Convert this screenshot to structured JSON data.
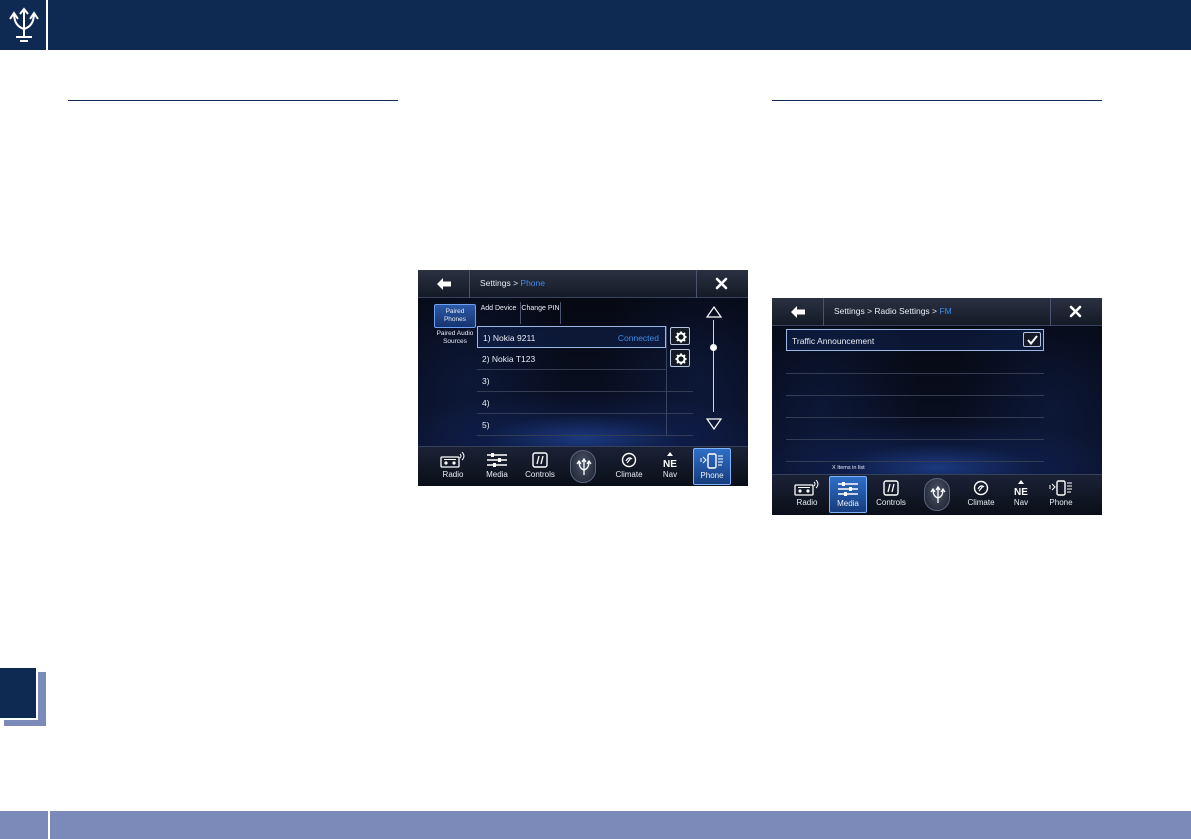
{
  "page": {
    "colors": {
      "navy": "#0e2a52",
      "slate": "#7b8ab8",
      "accent_blue": "#3a8fe8"
    }
  },
  "phone_screen": {
    "breadcrumb_prefix": "Settings > ",
    "breadcrumb_current": "Phone",
    "side_tabs": [
      "Paired Phones",
      "Paired Audio Sources"
    ],
    "toolbar": {
      "add_device": "Add Device",
      "change_pin": "Change PIN"
    },
    "devices": [
      {
        "label": "1) Nokia 9211",
        "status": "Connected"
      },
      {
        "label": "2) Nokia T123",
        "status": ""
      },
      {
        "label": "3)",
        "status": ""
      },
      {
        "label": "4)",
        "status": ""
      },
      {
        "label": "5)",
        "status": ""
      }
    ],
    "nav": [
      "Radio",
      "Media",
      "Controls",
      "Climate",
      "Nav",
      "Phone"
    ],
    "active_nav": "Phone",
    "compass": "NE"
  },
  "radio_screen": {
    "breadcrumb_prefix": "Settings > Radio Settings > ",
    "breadcrumb_current": "FM",
    "option": "Traffic Announcement",
    "option_checked": true,
    "items_caption": "X Items in list",
    "nav": [
      "Radio",
      "Media",
      "Controls",
      "Climate",
      "Nav",
      "Phone"
    ],
    "active_nav": "Media",
    "compass": "NE"
  }
}
